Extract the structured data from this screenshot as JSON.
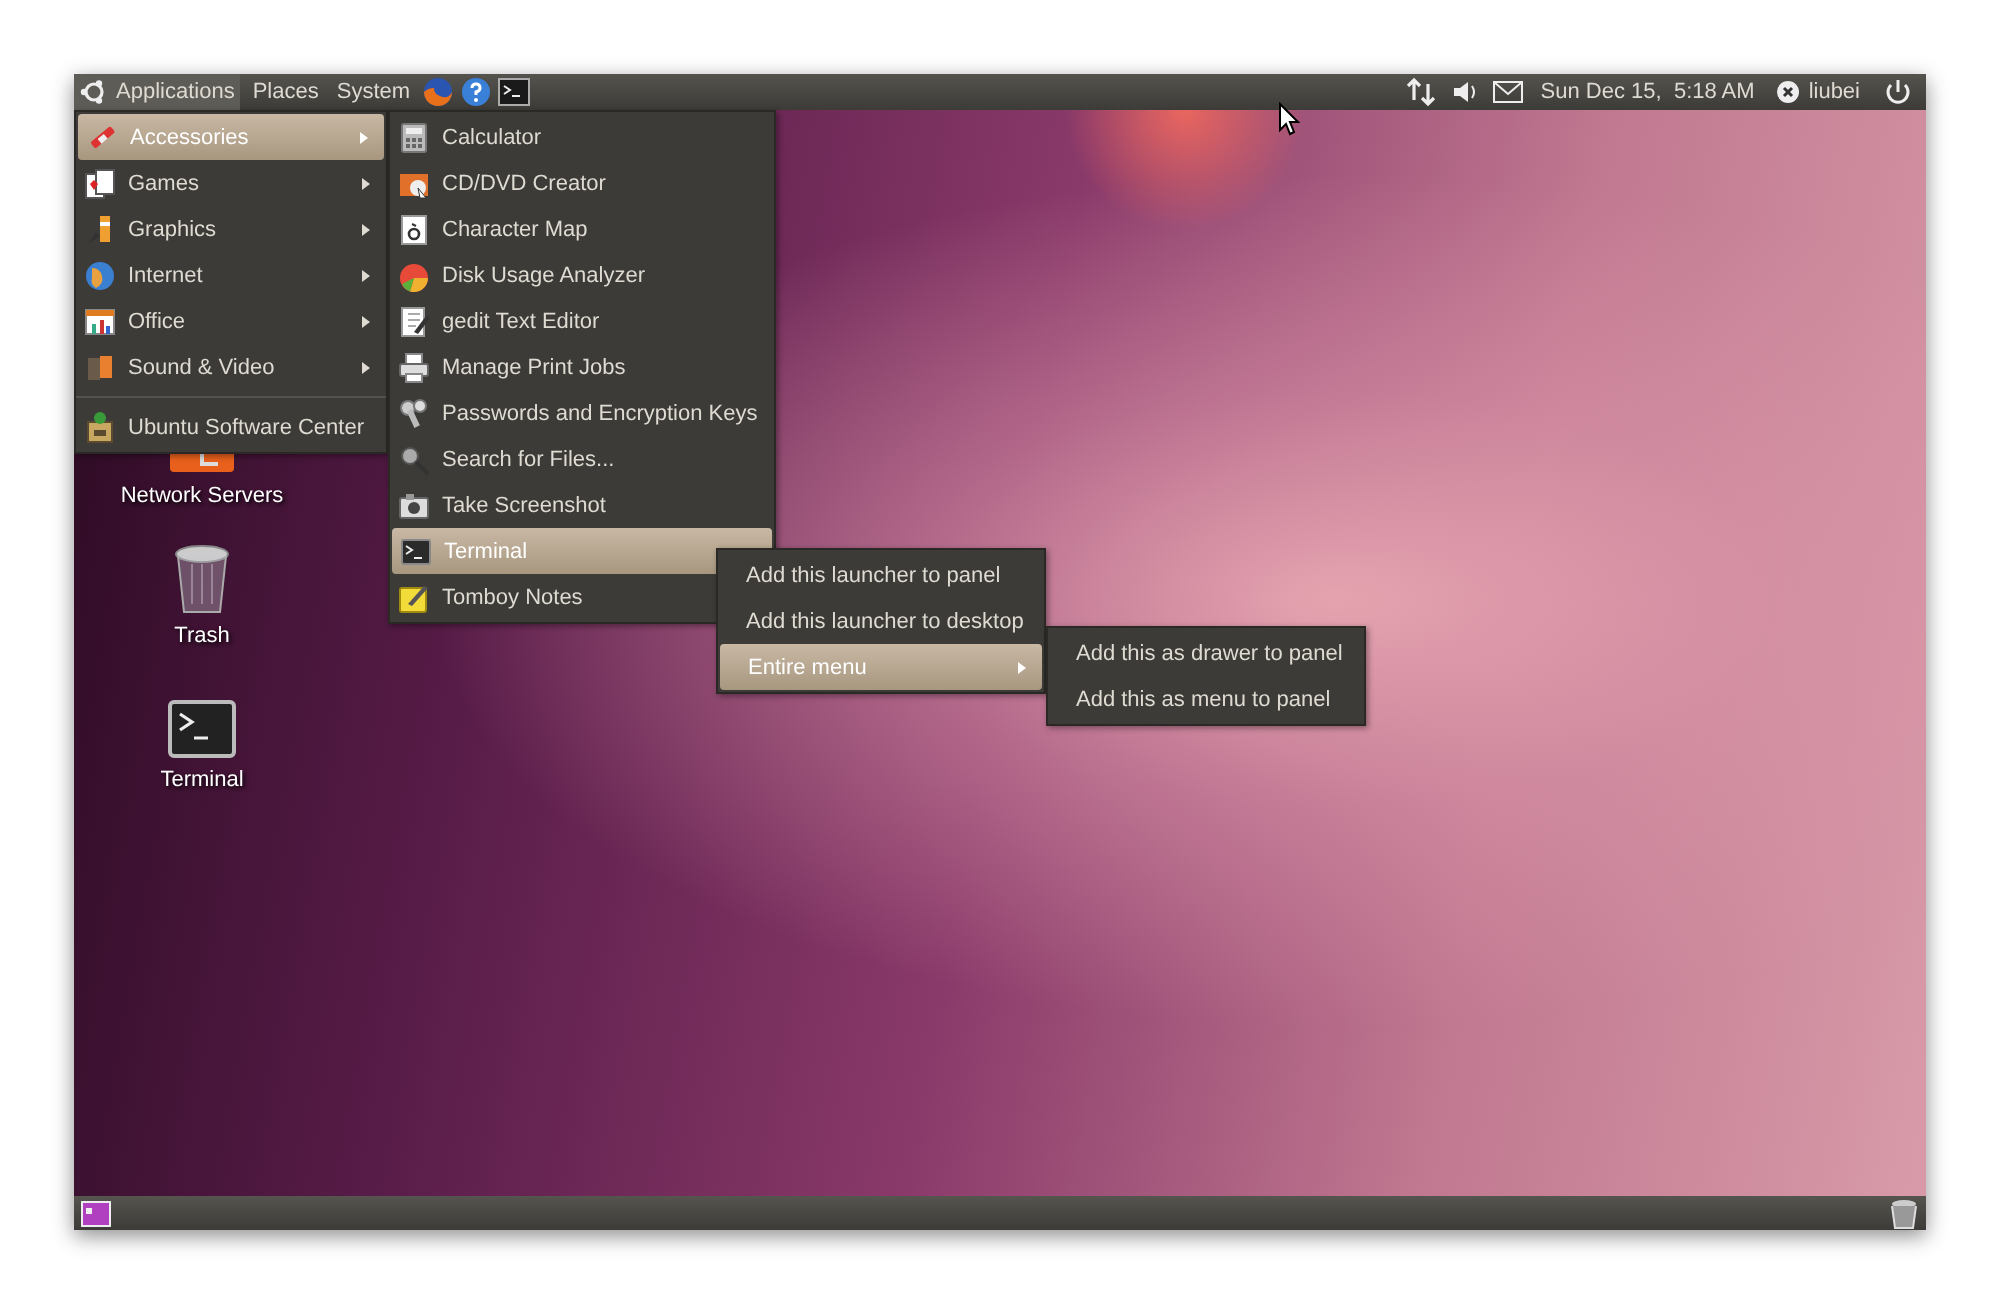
{
  "top_panel": {
    "menus": [
      {
        "label": "Applications",
        "selected": true
      },
      {
        "label": "Places",
        "selected": false
      },
      {
        "label": "System",
        "selected": false
      }
    ],
    "clock": "Sun Dec 15,  5:18 AM",
    "user": "liubei"
  },
  "applications_menu": {
    "items": [
      {
        "kind": "submenu",
        "label": "Accessories",
        "selected": true
      },
      {
        "kind": "submenu",
        "label": "Games",
        "selected": false
      },
      {
        "kind": "submenu",
        "label": "Graphics",
        "selected": false
      },
      {
        "kind": "submenu",
        "label": "Internet",
        "selected": false
      },
      {
        "kind": "submenu",
        "label": "Office",
        "selected": false
      },
      {
        "kind": "submenu",
        "label": "Sound & Video",
        "selected": false
      },
      {
        "kind": "separator"
      },
      {
        "kind": "launcher",
        "label": "Ubuntu Software Center",
        "selected": false
      }
    ]
  },
  "accessories_menu": {
    "items": [
      {
        "kind": "launcher",
        "label": "Calculator",
        "selected": false
      },
      {
        "kind": "launcher",
        "label": "CD/DVD Creator",
        "selected": false
      },
      {
        "kind": "launcher",
        "label": "Character Map",
        "selected": false
      },
      {
        "kind": "launcher",
        "label": "Disk Usage Analyzer",
        "selected": false
      },
      {
        "kind": "launcher",
        "label": "gedit Text Editor",
        "selected": false
      },
      {
        "kind": "launcher",
        "label": "Manage Print Jobs",
        "selected": false
      },
      {
        "kind": "launcher",
        "label": "Passwords and Encryption Keys",
        "selected": false
      },
      {
        "kind": "launcher",
        "label": "Search for Files...",
        "selected": false
      },
      {
        "kind": "launcher",
        "label": "Take Screenshot",
        "selected": false
      },
      {
        "kind": "launcher",
        "label": "Terminal",
        "selected": true
      },
      {
        "kind": "launcher",
        "label": "Tomboy Notes",
        "selected": false
      }
    ]
  },
  "context_menu": {
    "items": [
      {
        "kind": "plain",
        "label": "Add this launcher to panel",
        "selected": false
      },
      {
        "kind": "plain",
        "label": "Add this launcher to desktop",
        "selected": false
      },
      {
        "kind": "submenu",
        "label": "Entire menu",
        "selected": true
      }
    ]
  },
  "entire_menu_submenu": {
    "items": [
      {
        "kind": "plain",
        "label": "Add this as drawer to panel",
        "selected": false
      },
      {
        "kind": "plain",
        "label": "Add this as menu to panel",
        "selected": false
      }
    ]
  },
  "desktop_icons": [
    {
      "label": "Network Servers"
    },
    {
      "label": "Trash"
    },
    {
      "label": "Terminal"
    }
  ]
}
